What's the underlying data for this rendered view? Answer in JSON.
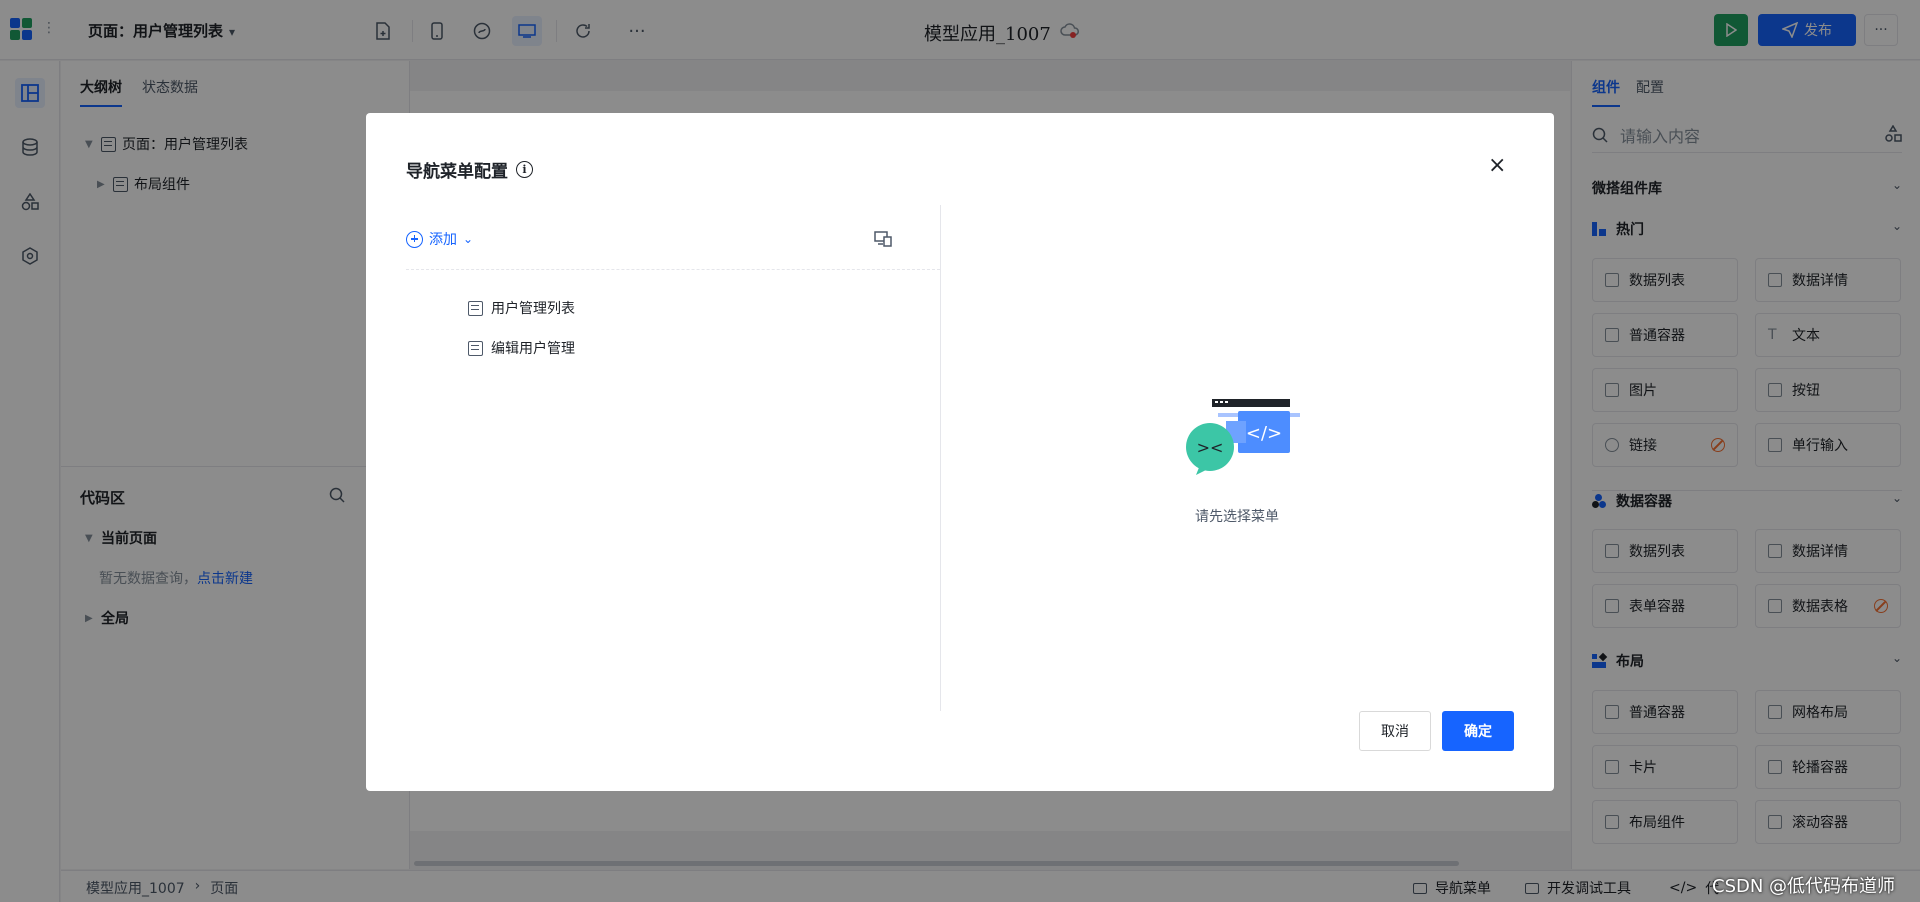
{
  "header": {
    "page_select_label": "页面：用户管理列表",
    "app_title": "模型应用_1007",
    "publish_label": "发布"
  },
  "outline": {
    "tabs": [
      "大纲树",
      "状态数据"
    ],
    "tree": [
      {
        "label": "页面：用户管理列表"
      },
      {
        "label": "布局组件"
      }
    ],
    "code_area": {
      "title": "代码区",
      "current_page": "当前页面",
      "empty_text": "暂无数据查询，",
      "create_link": "点击新建",
      "global": "全局"
    }
  },
  "right_panel": {
    "tabs": [
      "组件",
      "配置"
    ],
    "search_placeholder": "请输入内容",
    "library_title": "微搭组件库",
    "sections": [
      {
        "title": "热门",
        "items": [
          "数据列表",
          "数据详情",
          "普通容器",
          "文本",
          "图片",
          "按钮",
          "链接",
          "单行输入"
        ]
      },
      {
        "title": "数据容器",
        "items": [
          "数据列表",
          "数据详情",
          "表单容器",
          "数据表格"
        ]
      },
      {
        "title": "布局",
        "items": [
          "普通容器",
          "网格布局",
          "卡片",
          "轮播容器",
          "布局组件",
          "滚动容器"
        ]
      }
    ]
  },
  "statusbar": {
    "breadcrumb": [
      "模型应用_1007",
      "页面"
    ],
    "items": [
      "导航菜单",
      "开发调试工具",
      "代"
    ],
    "watermark": "CSDN @低代码布道师"
  },
  "modal": {
    "title": "导航菜单配置",
    "add_label": "添加",
    "menu_items": [
      "用户管理列表",
      "编辑用户管理"
    ],
    "empty_text": "请先选择菜单",
    "cancel_label": "取消",
    "ok_label": "确定"
  },
  "colors": {
    "primary": "#1664ff",
    "run_green": "#20a162",
    "warning": "#f77234"
  }
}
